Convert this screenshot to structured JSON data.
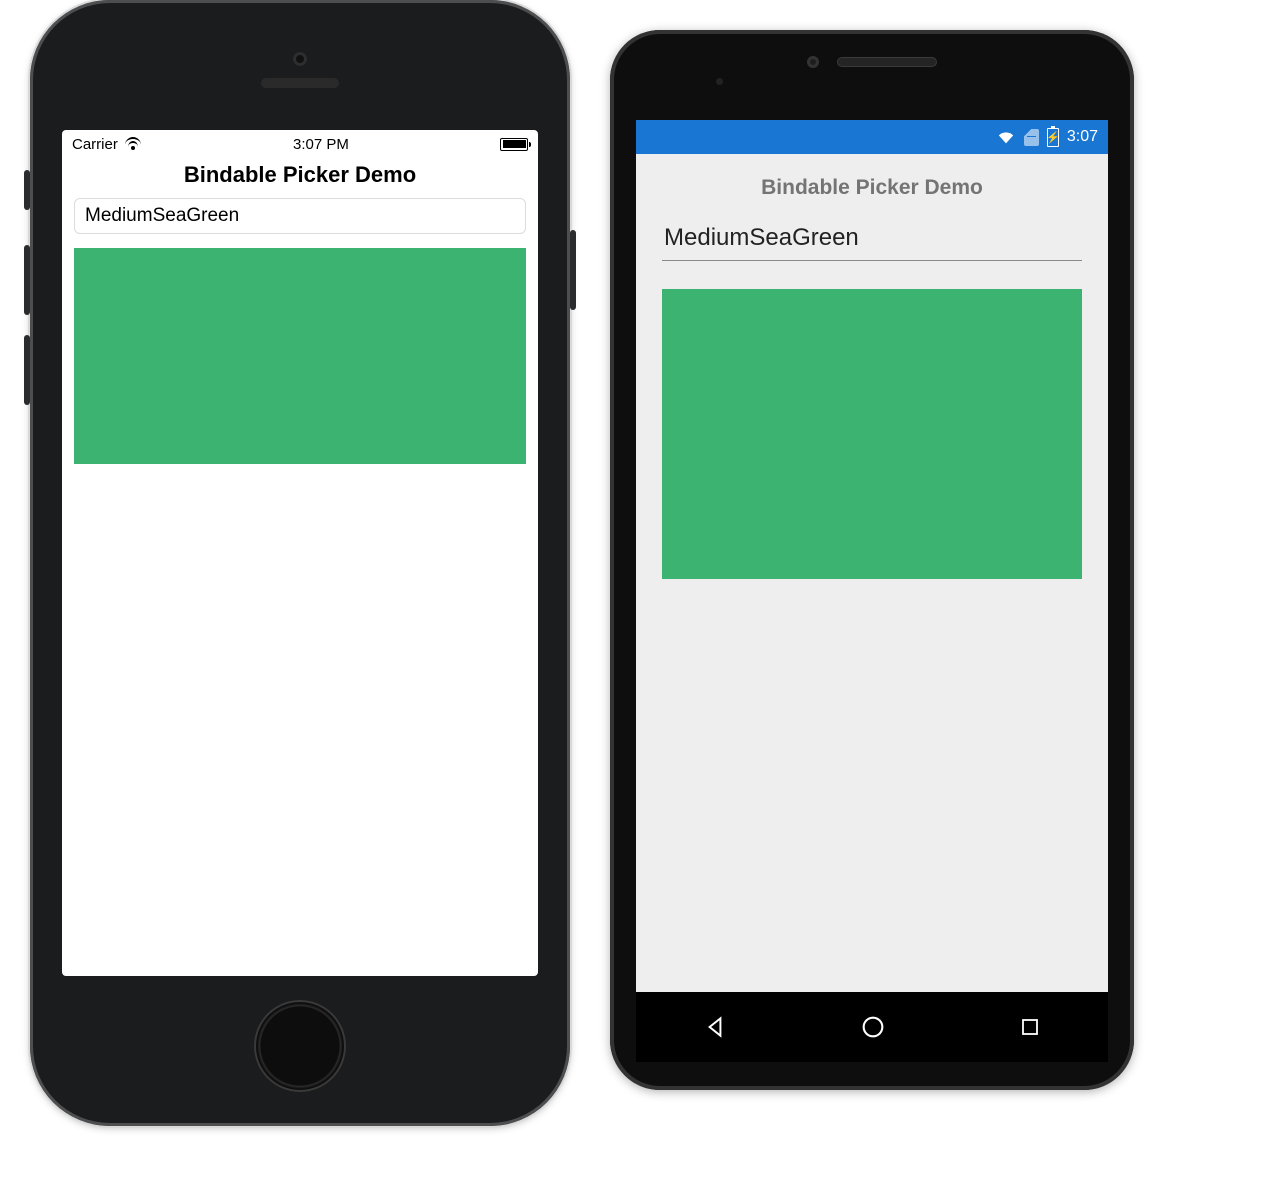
{
  "ios": {
    "status": {
      "carrier": "Carrier",
      "time": "3:07 PM"
    },
    "title": "Bindable Picker Demo",
    "picker_value": "MediumSeaGreen",
    "swatch_color": "#3CB371"
  },
  "android": {
    "status": {
      "time": "3:07"
    },
    "title": "Bindable Picker Demo",
    "picker_value": "MediumSeaGreen",
    "swatch_color": "#3CB371"
  }
}
